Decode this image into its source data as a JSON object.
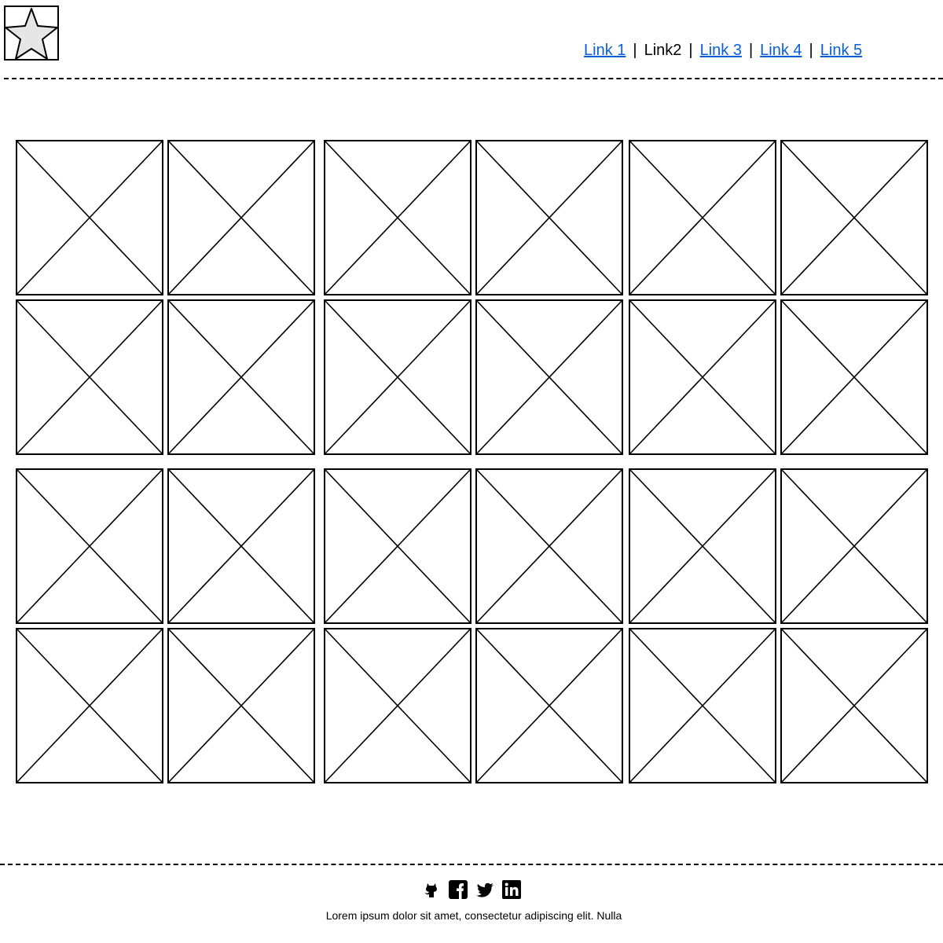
{
  "header": {
    "logo_icon": "star-icon",
    "nav": {
      "links": [
        {
          "label": "Link 1",
          "current": false
        },
        {
          "label": "Link2",
          "current": true
        },
        {
          "label": "Link 3",
          "current": false
        },
        {
          "label": "Link 4",
          "current": false
        },
        {
          "label": "Link 5",
          "current": false
        }
      ],
      "separator": "|"
    }
  },
  "main": {
    "image_placeholders": {
      "count": 24,
      "icon": "image-placeholder-icon"
    }
  },
  "footer": {
    "social_icons": [
      "github-icon",
      "facebook-icon",
      "twitter-icon",
      "linkedin-icon"
    ],
    "text": "Lorem ipsum dolor sit amet, consectetur adipiscing elit. Nulla"
  }
}
